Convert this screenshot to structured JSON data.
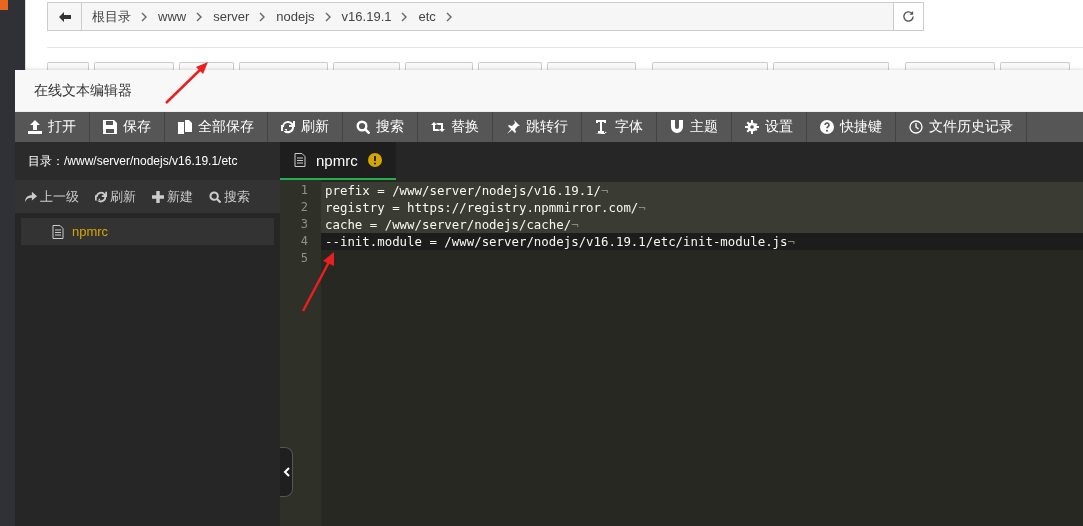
{
  "breadcrumb": {
    "items": [
      "根目录",
      "www",
      "server",
      "nodejs",
      "v16.19.1",
      "etc"
    ]
  },
  "editor": {
    "title": "在线文本编辑器",
    "toolbar": [
      {
        "kind": "upload",
        "label": "打开"
      },
      {
        "kind": "save",
        "label": "保存"
      },
      {
        "kind": "copy",
        "label": "全部保存"
      },
      {
        "kind": "refresh",
        "label": "刷新"
      },
      {
        "kind": "search",
        "label": "搜索"
      },
      {
        "kind": "swap",
        "label": "替换"
      },
      {
        "kind": "pin",
        "label": "跳转行"
      },
      {
        "kind": "font",
        "label": "字体"
      },
      {
        "kind": "magnet",
        "label": "主题"
      },
      {
        "kind": "gear",
        "label": "设置"
      },
      {
        "kind": "help",
        "label": "快捷键"
      },
      {
        "kind": "clock",
        "label": "文件历史记录"
      }
    ],
    "directory": {
      "label": "目录：",
      "path": "/www/server/nodejs/v16.19.1/etc"
    },
    "side_actions": [
      {
        "kind": "up",
        "label": "上一级"
      },
      {
        "kind": "refresh",
        "label": "刷新"
      },
      {
        "kind": "plus",
        "label": "新建"
      },
      {
        "kind": "search",
        "label": "搜索"
      }
    ],
    "files": [
      {
        "name": "npmrc",
        "selected": true
      }
    ],
    "tabs": [
      {
        "name": "npmrc",
        "selected": true,
        "unsaved": true
      }
    ],
    "lines": [
      {
        "number": "1",
        "text": "prefix = /www/server/nodejs/v16.19.1/",
        "eol": "¬",
        "selected": true
      },
      {
        "number": "2",
        "text": "registry = https://registry.npmmirror.com/",
        "eol": "¬",
        "selected": true
      },
      {
        "number": "3",
        "text": "cache = /www/server/nodejs/cache/",
        "eol": "¬",
        "selected": true
      },
      {
        "number": "4",
        "text": "--init.module = /www/server/nodejs/v16.19.1/etc/init-module.js",
        "eol": "¬",
        "selected": false,
        "current": true
      },
      {
        "number": "5",
        "selected": false,
        "current": false
      }
    ]
  }
}
